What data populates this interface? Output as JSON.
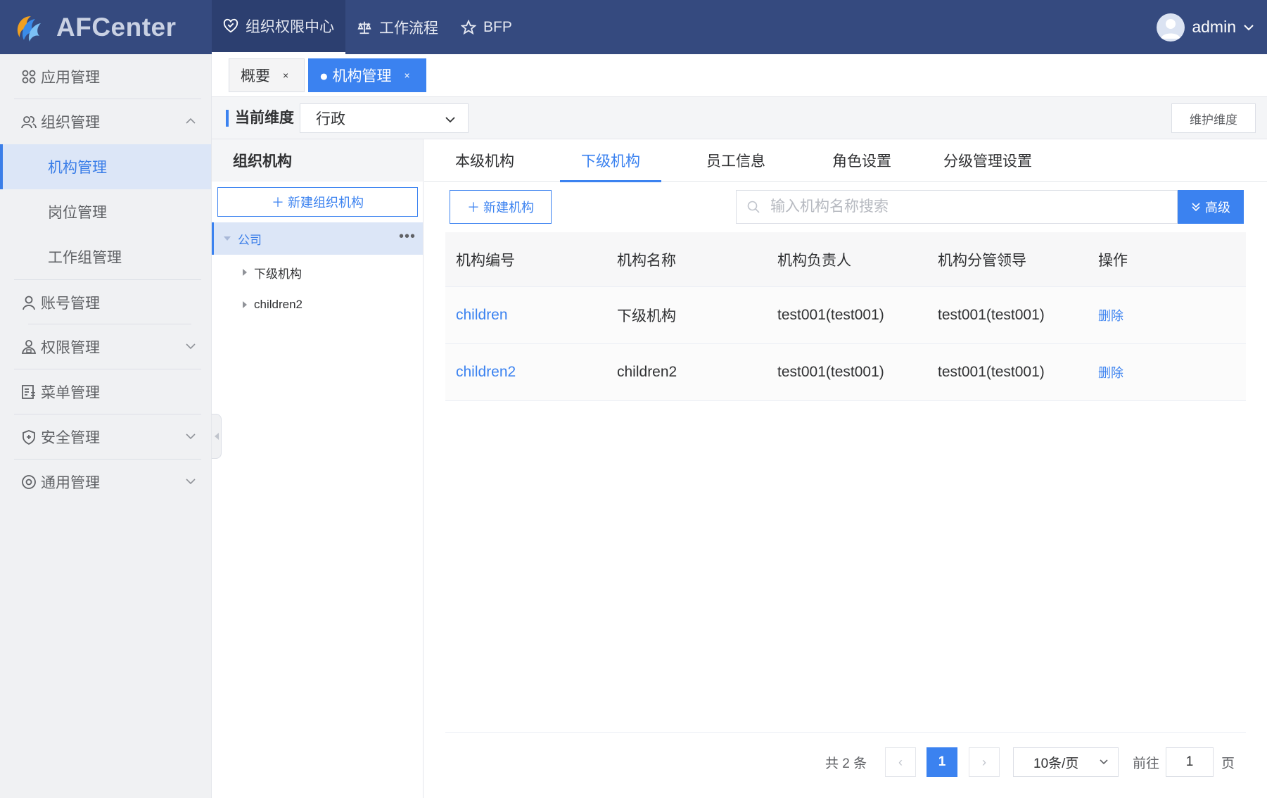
{
  "header": {
    "app_name": "AFCenter",
    "nav": [
      {
        "label": "组织权限中心",
        "icon": "heart-shield-icon",
        "active": true
      },
      {
        "label": "工作流程",
        "icon": "scale-icon",
        "active": false
      },
      {
        "label": "BFP",
        "icon": "star-icon",
        "active": false
      }
    ],
    "user": {
      "name": "admin",
      "icon": "avatar-icon"
    }
  },
  "sidebar": {
    "items": [
      {
        "label": "应用管理",
        "icon": "grid-icon"
      },
      {
        "label": "组织管理",
        "icon": "users-icon",
        "expanded": true,
        "children": [
          {
            "label": "机构管理",
            "active": true
          },
          {
            "label": "岗位管理"
          },
          {
            "label": "工作组管理"
          }
        ]
      },
      {
        "label": "账号管理",
        "icon": "user-icon"
      },
      {
        "label": "权限管理",
        "icon": "user-lock-icon"
      },
      {
        "label": "菜单管理",
        "icon": "menu-list-icon"
      },
      {
        "label": "安全管理",
        "icon": "shield-plus-icon"
      },
      {
        "label": "通用管理",
        "icon": "settings-circle-icon"
      }
    ]
  },
  "tabs": [
    {
      "label": "概要",
      "close": "×"
    },
    {
      "label": "● 机构管理",
      "close": "×",
      "active": true
    }
  ],
  "dimension": {
    "label": "当前维度",
    "value": "行政",
    "maintain_button": "维护维度"
  },
  "org_panel": {
    "title": "组织机构",
    "new_button": "＋ 新建组织机构",
    "tree": {
      "root": "公司",
      "more": "•••",
      "children": [
        "下级机构",
        "children2"
      ]
    }
  },
  "main": {
    "subtabs": [
      "本级机构",
      "下级机构",
      "员工信息",
      "角色设置",
      "分级管理设置"
    ],
    "active_subtab": "下级机构",
    "new_button": "＋ 新建机构",
    "search_placeholder": "输入机构名称搜索",
    "advanced_button": "高级",
    "table": {
      "columns": [
        "机构编号",
        "机构名称",
        "机构负责人",
        "机构分管领导",
        "操作"
      ],
      "rows": [
        {
          "code": "children",
          "name": "下级机构",
          "head": "test001(test001)",
          "leader": "test001(test001)",
          "action": "删除"
        },
        {
          "code": "children2",
          "name": "children2",
          "head": "test001(test001)",
          "leader": "test001(test001)",
          "action": "删除"
        }
      ]
    },
    "pagination": {
      "total": "共 2 条",
      "prev": "‹",
      "current": "1",
      "next": "›",
      "page_size": "10条/页",
      "goto_label": "前往",
      "goto_value": "1",
      "page_suffix": "页"
    }
  },
  "colors": {
    "header_bg": "#354a7f",
    "accent": "#3b82f0",
    "sidebar_bg": "#f0f1f3",
    "active_bg": "#dce6f7"
  }
}
